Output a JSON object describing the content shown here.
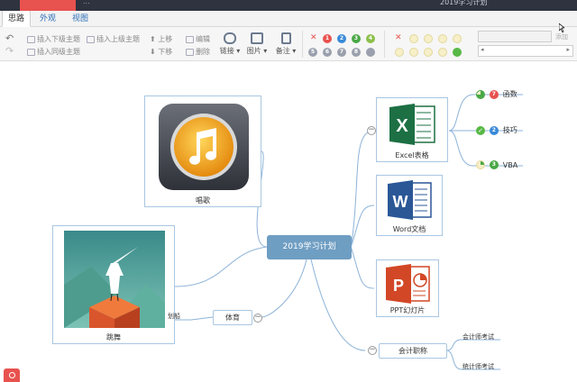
{
  "titlebar": {
    "tab_label": "",
    "document_path": "...",
    "window_title": "2019学习计划"
  },
  "tabs": [
    {
      "label": "思路"
    },
    {
      "label": "外观"
    },
    {
      "label": "视图"
    }
  ],
  "toolbar": {
    "insert_child": "插入下级主题",
    "insert_sibling": "插入同级主题",
    "insert_parent": "插入上级主题",
    "move_up": "上移",
    "move_down": "下移",
    "edit": "编辑",
    "delete": "删除",
    "link": "链接",
    "image": "图片",
    "note": "备注",
    "search_button": "添加",
    "priority_labels": [
      "1",
      "2",
      "3",
      "4",
      "5",
      "6",
      "7",
      "8"
    ]
  },
  "mindmap": {
    "root": "2019学习计划",
    "branches": [
      {
        "label": "唱歌",
        "icon": "music-app-icon"
      },
      {
        "label": "跳舞",
        "icon": "monument-valley-image"
      },
      {
        "label": "Excel表格",
        "icon": "excel-icon"
      },
      {
        "label": "Word文档",
        "icon": "word-icon"
      },
      {
        "label": "PPT幻灯片",
        "icon": "powerpoint-icon"
      },
      {
        "label": "会计职称",
        "icon": ""
      },
      {
        "label": "体育",
        "icon": ""
      }
    ],
    "excel_children": [
      {
        "label": "函数",
        "priority": "7",
        "priority_color": "#e8524f"
      },
      {
        "label": "技巧",
        "priority": "2",
        "priority_color": "#3a8ad8"
      },
      {
        "label": "VBA",
        "priority": "3",
        "priority_color": "#4aa946"
      }
    ],
    "accounting_children": [
      "会计师考试",
      "统计师考试"
    ],
    "sport_children": [
      "划船"
    ]
  },
  "colors": {
    "titlebar": "#2f3340",
    "accent": "#e8524f",
    "root_fill": "#6f9ec3",
    "link_line": "#8db3d8"
  }
}
